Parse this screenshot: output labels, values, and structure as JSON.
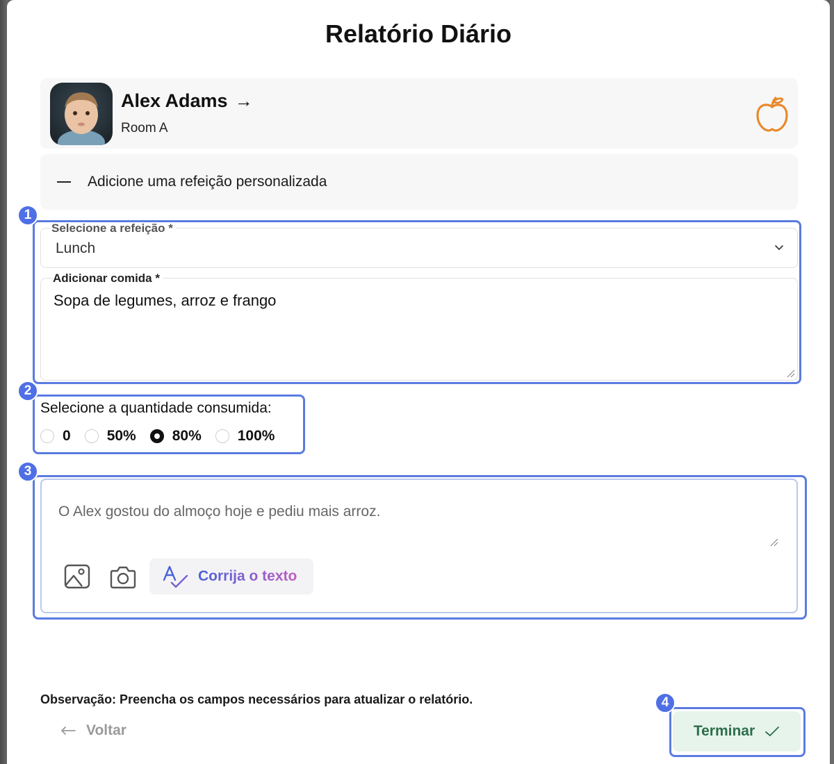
{
  "modal": {
    "title": "Relatório Diário"
  },
  "child": {
    "name": "Alex Adams",
    "arrow": "→",
    "room": "Room A",
    "meal_icon": "apple-icon"
  },
  "custom_meal": {
    "label": "Adicione uma refeição personalizada"
  },
  "meal_select": {
    "label": "Selecione a refeição *",
    "value": "Lunch"
  },
  "food": {
    "label": "Adicionar comida *",
    "value": "Sopa de legumes, arroz e frango"
  },
  "quantity": {
    "label": "Selecione a quantidade consumida:",
    "options": [
      "0",
      "50%",
      "80%",
      "100%"
    ],
    "selected": "80%"
  },
  "note": {
    "placeholder": "O Alex gostou do almoço hoje e pediu mais arroz.",
    "fix_label": "Corrija o texto"
  },
  "footer": {
    "observation": "Observação: Preencha os campos necessários para atualizar o relatório.",
    "back_label": "Voltar",
    "finish_label": "Terminar"
  },
  "annotations": {
    "badges": [
      "1",
      "2",
      "3",
      "4"
    ],
    "highlight_color": "#5a7be0"
  },
  "colors": {
    "accent_orange": "#e8892b",
    "finish_green": "#2e6e4a",
    "finish_bg": "#e6f4ec"
  }
}
